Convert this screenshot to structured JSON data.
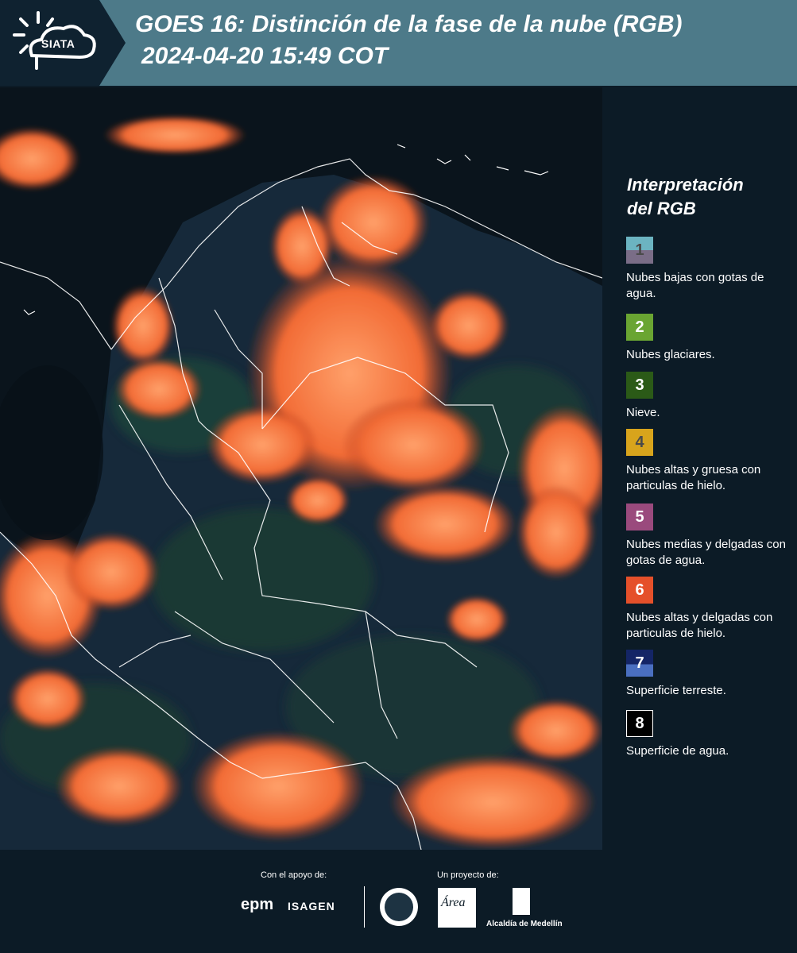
{
  "header": {
    "logo_text": "SIATA",
    "title": "GOES 16: Distinción de la fase de la nube (RGB)",
    "timestamp": "2024-04-20 15:49 COT"
  },
  "map": {
    "description_icon": "satellite-rgb-map-colombia"
  },
  "legend": {
    "title_line1": "Interpretación",
    "title_line2": "del RGB",
    "items": [
      {
        "number": "1",
        "label": "Nubes bajas con gotas de agua.",
        "color_top": "#6cb4c1",
        "color_bottom": "#7a6d87"
      },
      {
        "number": "2",
        "label": "Nubes glaciares.",
        "color_top": "#6aa532",
        "color_bottom": "#6aa532"
      },
      {
        "number": "3",
        "label": "Nieve.",
        "color_top": "#2b5a17",
        "color_bottom": "#2b5a17"
      },
      {
        "number": "4",
        "label": "Nubes altas y gruesa con particulas de hielo.",
        "color_top": "#d8a41c",
        "color_bottom": "#d8a41c"
      },
      {
        "number": "5",
        "label": "Nubes medias y delgadas con gotas de agua.",
        "color_top": "#9a4a7d",
        "color_bottom": "#9a4a7d"
      },
      {
        "number": "6",
        "label": "Nubes altas y delgadas con particulas de hielo.",
        "color_top": "#e5502a",
        "color_bottom": "#e5502a"
      },
      {
        "number": "7",
        "label": "Superficie terreste.",
        "color_top": "#142566",
        "color_bottom": "#4a6fc0"
      },
      {
        "number": "8",
        "label": "Superficie de agua.",
        "color_top": "#000000",
        "color_bottom": "#000000"
      }
    ]
  },
  "footer": {
    "support_label": "Con el apoyo de:",
    "project_label": "Un proyecto de:",
    "epm": "epm",
    "isagen": "ISAGEN",
    "area_logo": "Área",
    "alcaldia": "Alcaldía de Medellín"
  },
  "colors": {
    "header_bg": "#4d7a89",
    "page_bg": "#0c1b26",
    "cloud_orange": "#f26b35",
    "cloud_light": "#fb9a5c",
    "land_dark": "#15293b",
    "border_white": "#ffffff"
  }
}
